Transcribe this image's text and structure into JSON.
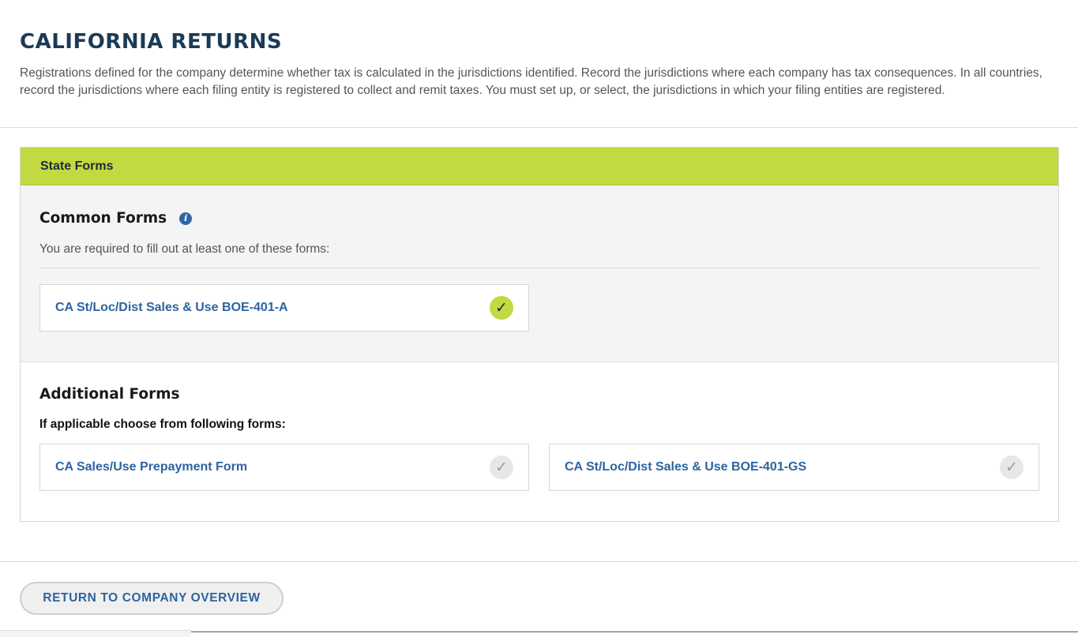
{
  "page": {
    "title": "CALIFORNIA RETURNS",
    "description": "Registrations defined for the company determine whether tax is calculated in the jurisdictions identified. Record the jurisdictions where each company has tax consequences. In all countries, record the jurisdictions where each filing entity is registered to collect and remit taxes. You must set up, or select, the jurisdictions in which your filing entities are registered."
  },
  "panel": {
    "header": "State Forms",
    "common": {
      "title": "Common Forms",
      "info_icon": "info-icon",
      "subtitle": "You are required to fill out at least one of these forms:",
      "forms": [
        {
          "label": "CA St/Loc/Dist Sales & Use BOE-401-A",
          "selected": true,
          "check_icon": "✓"
        }
      ]
    },
    "additional": {
      "title": "Additional Forms",
      "subtitle": "If applicable choose from following forms:",
      "forms": [
        {
          "label": "CA Sales/Use Prepayment Form",
          "selected": false,
          "check_icon": "✓"
        },
        {
          "label": "CA St/Loc/Dist Sales & Use BOE-401-GS",
          "selected": false,
          "check_icon": "✓"
        }
      ]
    }
  },
  "footer": {
    "return_button": "RETURN TO COMPANY OVERVIEW"
  },
  "colors": {
    "accent_green": "#c3d941",
    "title_navy": "#1c3a57",
    "link_blue": "#2d64a0"
  }
}
